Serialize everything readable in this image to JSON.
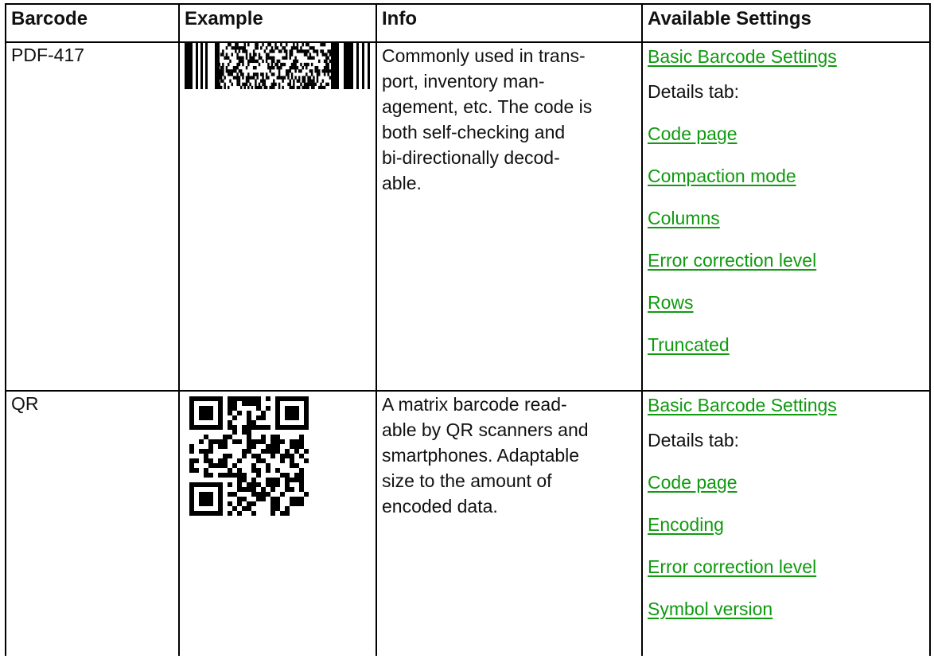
{
  "table": {
    "headers": {
      "barcode": "Barcode",
      "example": "Example",
      "info": "Info",
      "available_settings": "Available Settings"
    },
    "rows": [
      {
        "barcode": "PDF-417",
        "example_icon": "pdf417-barcode-image",
        "info_lines": [
          "Commonly used in trans-",
          "port, inventory man-",
          "agement, etc. The code is",
          "both self-checking and",
          "bi-directionally decod-",
          "able."
        ],
        "basic_settings_link": "Basic Barcode Settings",
        "details_label": "Details tab:",
        "settings": [
          "Code page",
          "Compaction mode",
          "Columns",
          "Error correction level",
          "Rows",
          "Truncated"
        ]
      },
      {
        "barcode": "QR",
        "example_icon": "qr-code-image",
        "info_lines": [
          "A matrix barcode read-",
          "able by QR scanners and",
          "smartphones. Adaptable",
          "size to the amount of",
          "encoded data."
        ],
        "basic_settings_link": "Basic Barcode Settings",
        "details_label": "Details tab:",
        "settings": [
          "Code page",
          "Encoding",
          "Error correction level",
          "Symbol version"
        ]
      }
    ]
  },
  "colors": {
    "link": "#109a10",
    "border": "#000000",
    "text": "#111111"
  }
}
